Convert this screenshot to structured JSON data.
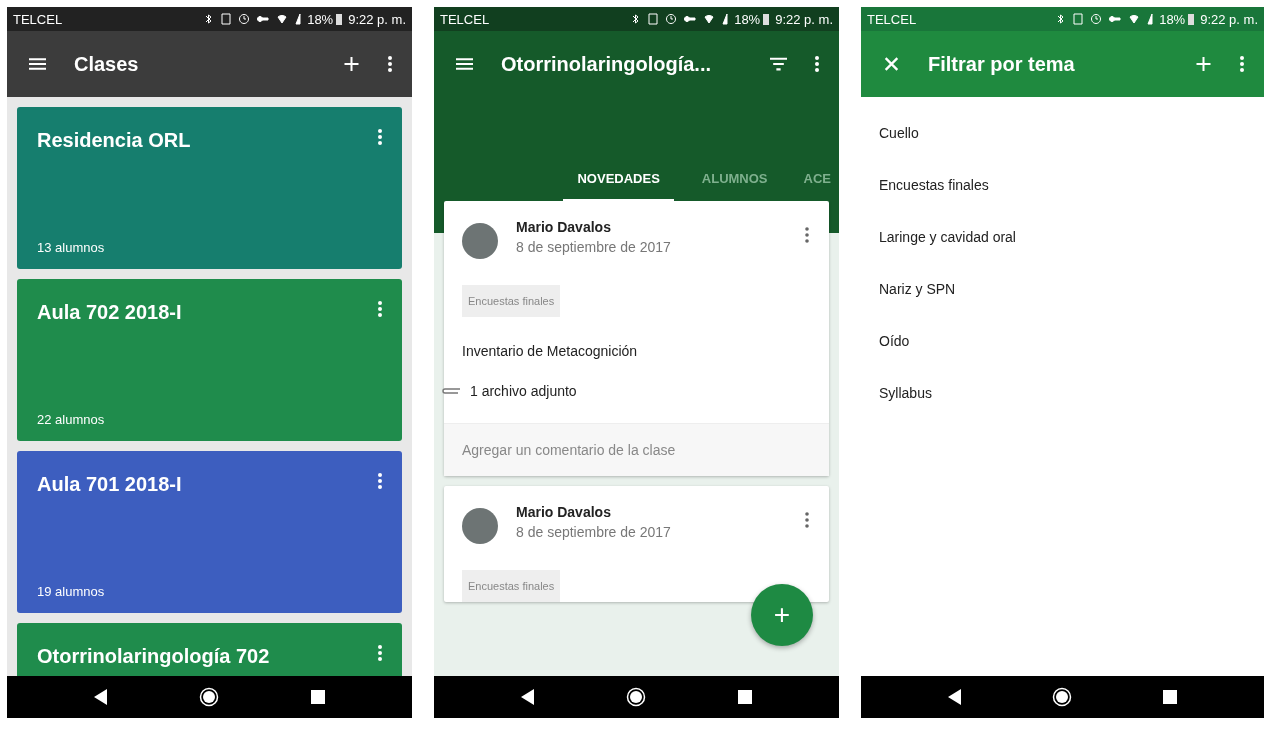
{
  "class_list": {
    "status_bar": {
      "carrier": "TELCEL",
      "battery": "18%",
      "time": "9:22 p. m."
    },
    "toolbar": {
      "title": "Clases"
    },
    "classes": [
      {
        "name": "Residencia ORL",
        "students": "13 alumnos",
        "color": "#167e6e"
      },
      {
        "name": "Aula 702 2018-I",
        "students": "22 alumnos",
        "color": "#1f8c4c"
      },
      {
        "name": "Aula 701 2018-I",
        "students": "19 alumnos",
        "color": "#3d5ebf"
      },
      {
        "name": "Otorrinolaringología 702",
        "color": "#1f8c4c"
      }
    ]
  },
  "class_stream": {
    "status_bar": {
      "carrier": "TELCEL",
      "battery": "18%",
      "time": "9:22 p. m."
    },
    "toolbar": {
      "title": "Otorrinolaringología..."
    },
    "tabs": [
      {
        "label": "NOVEDADES",
        "selected": true
      },
      {
        "label": "ALUMNOS",
        "selected": false
      },
      {
        "label": "ACE",
        "selected": false
      }
    ],
    "posts": [
      {
        "author": "Mario Davalos",
        "date": "8 de septiembre de 2017",
        "topic": "Encuestas finales",
        "title": "Inventario de Metacognición",
        "attachments": "1 archivo adjunto",
        "comment": {
          "placeholder": "Agregar un comentario de la clase"
        }
      },
      {
        "author": "Mario Davalos",
        "date": "8 de septiembre de 2017",
        "topic": "Encuestas finales"
      }
    ],
    "fab": "+"
  },
  "topic_filter": {
    "status_bar": {
      "carrier": "TELCEL",
      "battery": "18%",
      "time": "9:22 p. m."
    },
    "toolbar": {
      "title": "Filtrar por tema"
    },
    "topics": [
      "Cuello",
      "Encuestas finales",
      "Laringe y cavidad oral",
      "Nariz y SPN",
      "Oído",
      "Syllabus"
    ]
  }
}
